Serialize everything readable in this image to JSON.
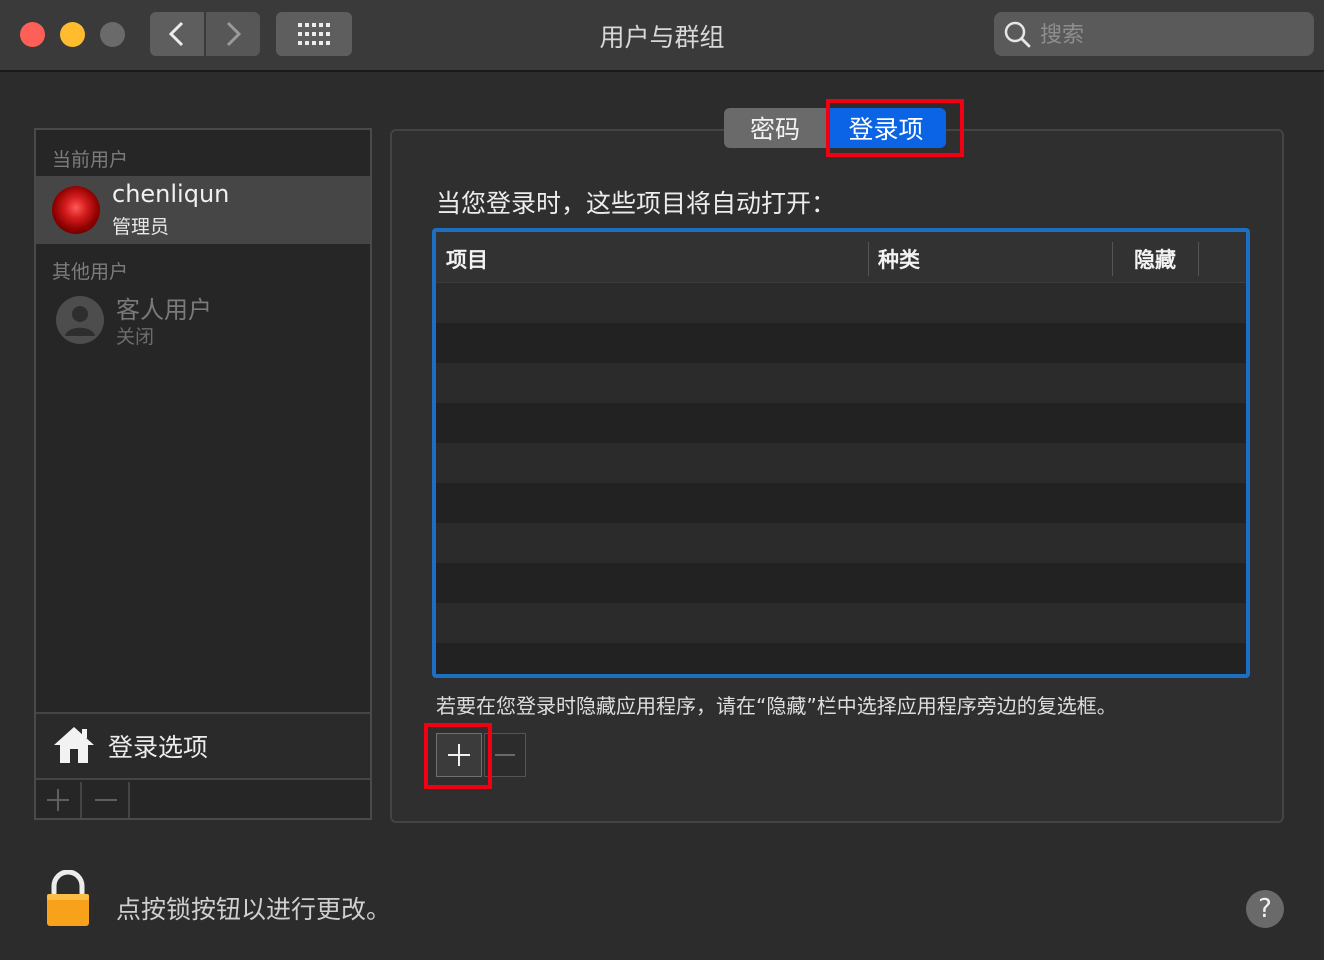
{
  "window": {
    "title": "用户与群组"
  },
  "search": {
    "placeholder": "搜索"
  },
  "sidebar": {
    "current_header": "当前用户",
    "current_user": {
      "name": "chenliqun",
      "role": "管理员"
    },
    "other_header": "其他用户",
    "guest_user": {
      "name": "客人用户",
      "status": "关闭"
    },
    "login_options": "登录选项"
  },
  "tabs": [
    {
      "label": "密码",
      "selected": false
    },
    {
      "label": "登录项",
      "selected": true
    }
  ],
  "main": {
    "intro": "当您登录时，这些项目将自动打开：",
    "columns": [
      "项目",
      "种类",
      "隐藏"
    ],
    "rows": [],
    "hint": "若要在您登录时隐藏应用程序，请在“隐藏”栏中选择应用程序旁边的复选框。"
  },
  "footer": {
    "lock_text": "点按锁按钮以进行更改。",
    "help_label": "?"
  },
  "colors": {
    "accent": "#0a64e5",
    "table_focus_ring": "#1d6fc2",
    "annotation_red": "#f00012"
  },
  "icons": [
    "chevron-left-icon",
    "chevron-right-icon",
    "grid-icon",
    "search-icon",
    "home-icon",
    "lock-icon",
    "plus-icon",
    "minus-icon",
    "question-icon"
  ]
}
